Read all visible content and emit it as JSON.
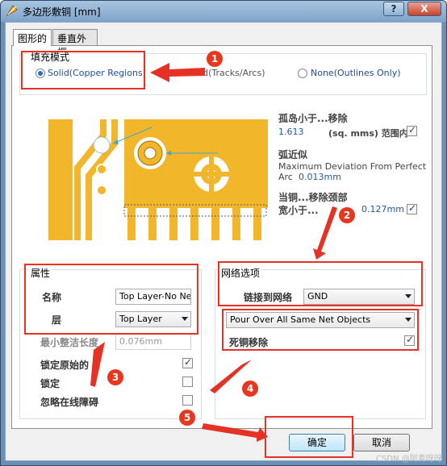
{
  "window": {
    "title": "多边形敷铜 [mm]",
    "help": "?",
    "close": "X"
  },
  "tabs": [
    {
      "label": "图形的"
    },
    {
      "label": "垂直外框"
    }
  ],
  "fill_mode": {
    "legend": "填充模式",
    "options": [
      {
        "label": "Solid(Copper Regions)",
        "selected": true
      },
      {
        "label": "Hatched(Tracks/Arcs)",
        "selected": false
      },
      {
        "label": "None(Outlines Only)",
        "selected": false
      }
    ]
  },
  "diagram": {
    "island": {
      "title": "孤岛小于...移除",
      "value": "1.613",
      "unit": "(sq. mms) 范围内",
      "checked": true
    },
    "arc": {
      "title": "弧近似",
      "line1": "Maximum Deviation From Perfect",
      "prefix": "Arc",
      "value": "0.013mm"
    },
    "neck": {
      "title1": "当铜...移除颈部",
      "title2": "宽小于...",
      "value": "0.127mm",
      "checked": true
    }
  },
  "properties": {
    "legend": "属性",
    "name_label": "名称",
    "name_value": "Top Layer-No Net",
    "layer_label": "层",
    "layer_value": "Top Layer",
    "min_length_label": "最小整洁长度",
    "min_length_value": "0.076mm",
    "lock_primitives_label": "锁定原始的",
    "lock_primitives_checked": true,
    "locked_label": "锁定",
    "locked_checked": false,
    "ignore_label": "忽略在线障碍",
    "ignore_checked": false
  },
  "net_options": {
    "legend": "网络选项",
    "connect_label": "链接到网络",
    "connect_value": "GND",
    "pour_value": "Pour Over All Same Net Objects",
    "remove_dead_label": "死铜移除",
    "remove_dead_checked": true
  },
  "buttons": {
    "ok": "确定",
    "cancel": "取消"
  },
  "annotations": [
    "1",
    "2",
    "3",
    "4",
    "5"
  ],
  "colors": {
    "annotation": "#e53224",
    "copper": "#f2b62a",
    "link": "#1f5aa6"
  },
  "watermark": "CSDN @阿青呀呀"
}
